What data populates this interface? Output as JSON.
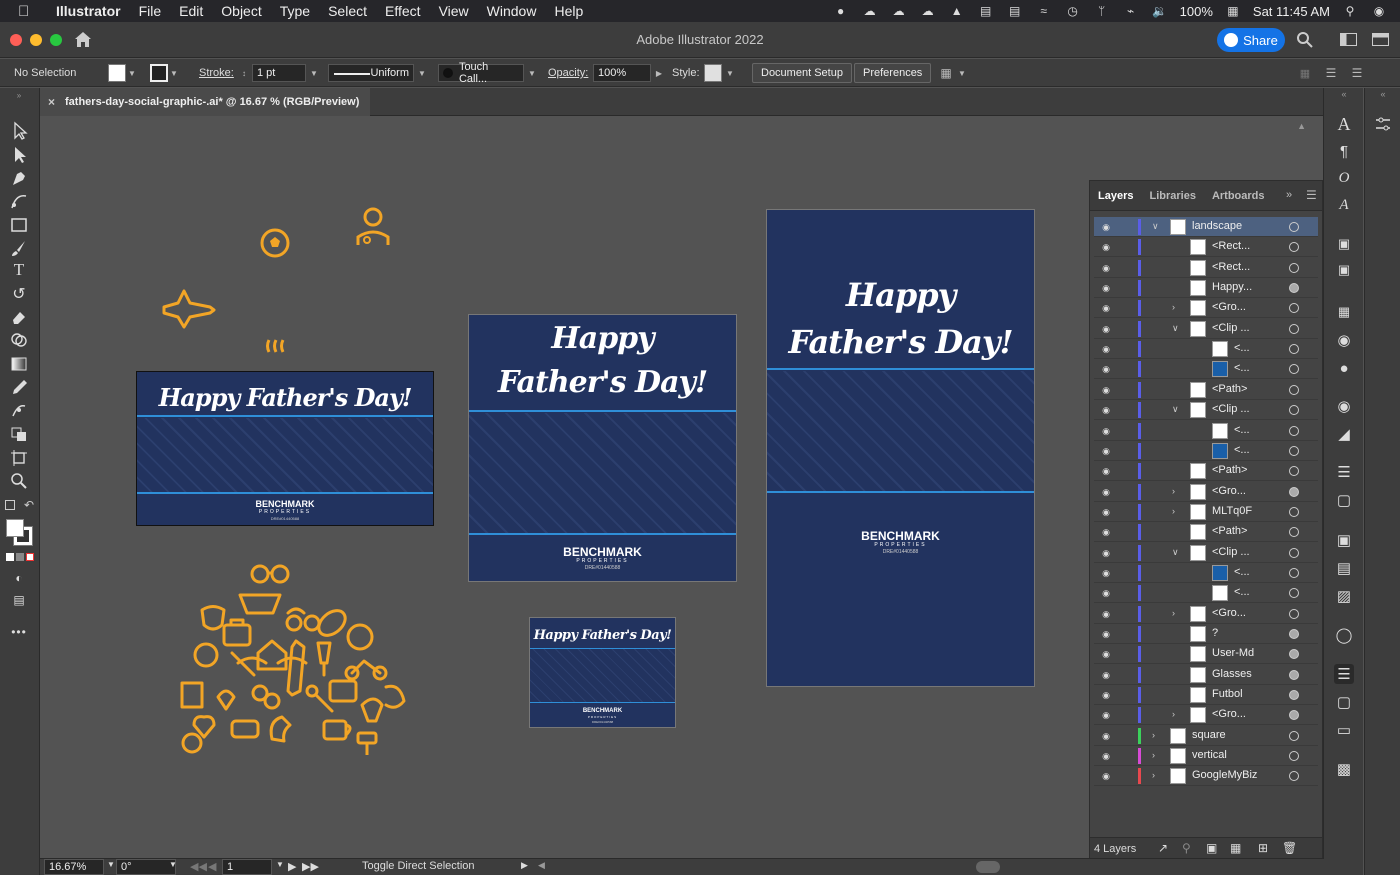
{
  "menubar": {
    "app_name": "Illustrator",
    "items": [
      "File",
      "Edit",
      "Object",
      "Type",
      "Select",
      "Effect",
      "View",
      "Window",
      "Help"
    ],
    "battery": "100%",
    "clock": "Sat 11:45 AM"
  },
  "titlebar": {
    "title": "Adobe Illustrator 2022",
    "share_label": "Share"
  },
  "control": {
    "selection_label": "No Selection",
    "stroke_label": "Stroke:",
    "stroke_weight": "1 pt",
    "profile": "Uniform",
    "brush": "Touch Call...",
    "opacity_label": "Opacity:",
    "opacity": "100%",
    "style_label": "Style:",
    "document_setup": "Document Setup",
    "preferences": "Preferences"
  },
  "doc_tab": {
    "name": "fathers-day-social-graphic-.ai* @ 16.67 % (RGB/Preview)"
  },
  "artwork": {
    "greeting_line": "Happy Father's Day!",
    "greeting_top": "Happy",
    "greeting_bottom": "Father's Day!",
    "brand": "BENCHMARK",
    "brand_sub": "PROPERTIES",
    "license": "DRE#01440588"
  },
  "layers_panel": {
    "tabs": [
      "Layers",
      "Libraries",
      "Artboards"
    ],
    "rows": [
      {
        "name": "landscape",
        "level": 0,
        "disc": "open",
        "selected": true,
        "target": "hollow"
      },
      {
        "name": "<Rect...",
        "level": 1,
        "disc": "none",
        "target": "hollow"
      },
      {
        "name": "<Rect...",
        "level": 1,
        "disc": "none",
        "target": "hollow"
      },
      {
        "name": "Happy...",
        "level": 1,
        "disc": "none",
        "target": "filled"
      },
      {
        "name": "<Gro...",
        "level": 1,
        "disc": "closed",
        "target": "hollow"
      },
      {
        "name": "<Clip ...",
        "level": 1,
        "disc": "open",
        "target": "hollow"
      },
      {
        "name": "<...",
        "level": 2,
        "disc": "none",
        "target": "hollow"
      },
      {
        "name": "<...",
        "level": 2,
        "disc": "none",
        "target": "hollow"
      },
      {
        "name": "<Path>",
        "level": 1,
        "disc": "none",
        "target": "hollow"
      },
      {
        "name": "<Clip ...",
        "level": 1,
        "disc": "open",
        "target": "hollow"
      },
      {
        "name": "<...",
        "level": 2,
        "disc": "none",
        "target": "hollow"
      },
      {
        "name": "<...",
        "level": 2,
        "disc": "none",
        "target": "hollow"
      },
      {
        "name": "<Path>",
        "level": 1,
        "disc": "none",
        "target": "hollow"
      },
      {
        "name": "<Gro...",
        "level": 1,
        "disc": "closed",
        "target": "filled"
      },
      {
        "name": "MLTq0F",
        "level": 1,
        "disc": "closed",
        "target": "hollow"
      },
      {
        "name": "<Path>",
        "level": 1,
        "disc": "none",
        "target": "hollow"
      },
      {
        "name": "<Clip ...",
        "level": 1,
        "disc": "open",
        "target": "hollow"
      },
      {
        "name": "<...",
        "level": 2,
        "disc": "none",
        "target": "hollow"
      },
      {
        "name": "<...",
        "level": 2,
        "disc": "none",
        "target": "hollow"
      },
      {
        "name": "<Gro...",
        "level": 1,
        "disc": "closed",
        "target": "hollow"
      },
      {
        "name": "?",
        "level": 1,
        "disc": "none",
        "target": "filled"
      },
      {
        "name": "User-Md",
        "level": 1,
        "disc": "none",
        "target": "filled"
      },
      {
        "name": "Glasses",
        "level": 1,
        "disc": "none",
        "target": "filled"
      },
      {
        "name": "Futbol",
        "level": 1,
        "disc": "none",
        "target": "filled"
      },
      {
        "name": "<Gro...",
        "level": 1,
        "disc": "closed",
        "target": "filled"
      },
      {
        "name": "square",
        "level": 0,
        "disc": "closed",
        "target": "hollow"
      },
      {
        "name": "vertical",
        "level": 0,
        "disc": "closed",
        "target": "hollow"
      },
      {
        "name": "GoogleMyBiz",
        "level": 0,
        "disc": "closed",
        "target": "hollow"
      }
    ],
    "layer_count": "4 Layers"
  },
  "status": {
    "zoom": "16.67%",
    "rotation": "0°",
    "artboard_num": "1",
    "tool_hint": "Toggle Direct Selection"
  },
  "colors": {
    "navy": "#22335f",
    "accent_orange": "#f2a526",
    "stripe_blue": "#2f8fd8",
    "selection_blue": "#4d6180"
  }
}
